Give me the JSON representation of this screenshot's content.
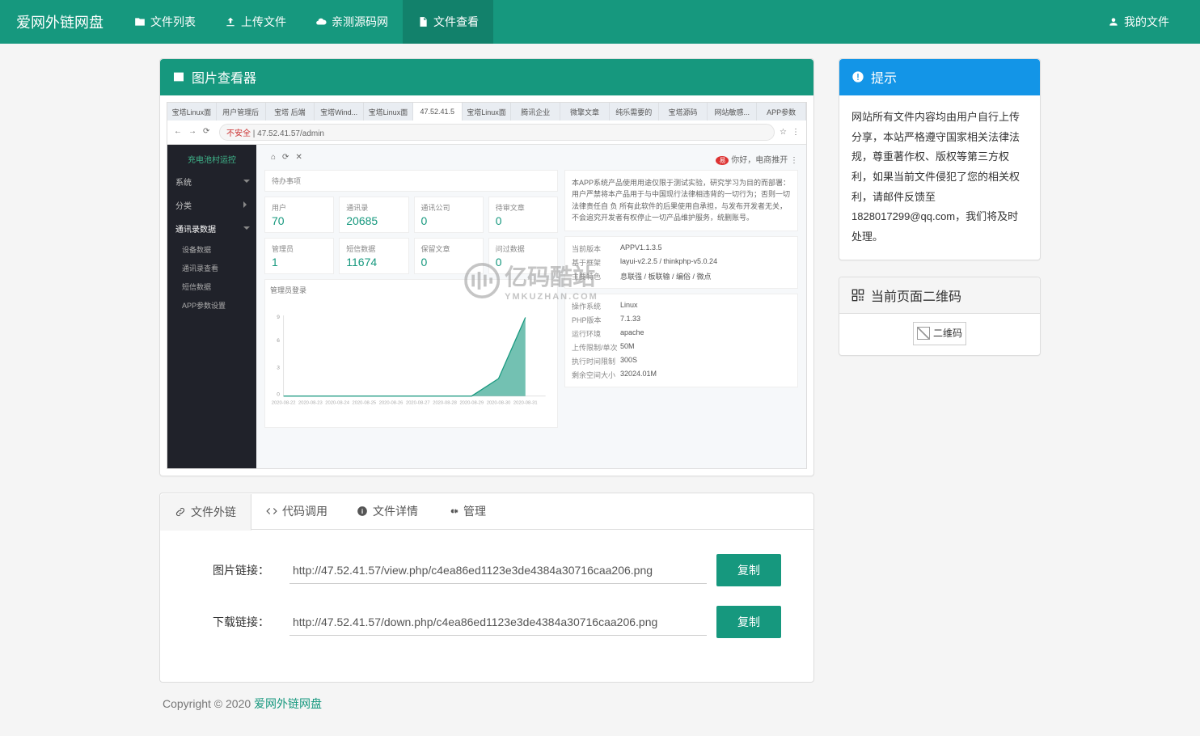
{
  "nav": {
    "brand": "爱网外链网盘",
    "items": [
      {
        "label": "文件列表",
        "icon": "folder-icon",
        "active": false
      },
      {
        "label": "上传文件",
        "icon": "upload-icon",
        "active": false
      },
      {
        "label": "亲测源码网",
        "icon": "cloud-icon",
        "active": false
      },
      {
        "label": "文件查看",
        "icon": "file-icon",
        "active": true
      }
    ],
    "right": {
      "label": "我的文件",
      "icon": "user-icon"
    }
  },
  "viewer": {
    "title": "图片查看器"
  },
  "screenshot": {
    "browser_tabs": [
      "宝塔Linux面",
      "用户管理后",
      "宝塔 后端",
      "宝塔Wind...",
      "宝塔Linux面",
      "47.52.41.5",
      "宝塔Linux面",
      "腾讯企业",
      "微擎文章",
      "纯乐需要的",
      "宝塔源码",
      "网站敏感...",
      "APP参数"
    ],
    "active_tab_index": 5,
    "url_security": "不安全",
    "url": "47.52.41.57/admin",
    "user_label": "你好，电商推开",
    "dashboard": {
      "logo": "充电池村运控",
      "menu": [
        {
          "label": "系统",
          "type": "expand"
        },
        {
          "label": "分类",
          "type": "collapse"
        },
        {
          "label": "通讯录数据",
          "type": "expand",
          "active": true
        },
        {
          "label": "设备数据",
          "type": "sub"
        },
        {
          "label": "通讯录查看",
          "type": "sub"
        },
        {
          "label": "短信数据",
          "type": "sub"
        },
        {
          "label": "APP参数设置",
          "type": "sub"
        }
      ],
      "pending_card": "待办事项",
      "stats": [
        {
          "label": "用户",
          "value": "70"
        },
        {
          "label": "通讯录",
          "value": "20685"
        },
        {
          "label": "通讯公司",
          "value": "0"
        },
        {
          "label": "待审文章",
          "value": "0"
        },
        {
          "label": "管理员",
          "value": "1"
        },
        {
          "label": "短信数据",
          "value": "11674"
        },
        {
          "label": "保留文章",
          "value": "0"
        },
        {
          "label": "问过数据",
          "value": "0"
        }
      ],
      "notice_text": "本APP系统产品使用用途仅限于测试实验，研究学习为目的而部署：用户严禁将本产品用于与中国现行法律相违背的一切行为；否则一切法律责任自 负 所有此软件的后果使用自承担，与发布开发者无关，不会追究开发者有权停止一切产品维护服务，统删账号。",
      "version_info": [
        {
          "k": "当前版本",
          "v": "APPV1.1.3.5"
        },
        {
          "k": "基于框架",
          "v": "layui-v2.2.5 / thinkphp-v5.0.24"
        },
        {
          "k": "主要特色",
          "v": "息联强 / 板联输 / 编俗 / 微点"
        }
      ],
      "sys_info": [
        {
          "k": "操作系统",
          "v": "Linux"
        },
        {
          "k": "PHP版本",
          "v": "7.1.33"
        },
        {
          "k": "运行环境",
          "v": "apache"
        },
        {
          "k": "上传限制/单次",
          "v": "50M"
        },
        {
          "k": "执行时间限制",
          "v": "300S"
        },
        {
          "k": "剩余空间大小",
          "v": "32024.01M"
        }
      ]
    }
  },
  "chart_data": {
    "type": "area",
    "title": "管理员登录",
    "categories": [
      "2020-08-22",
      "2020-08-23",
      "2020-08-24",
      "2020-08-25",
      "2020-08-26",
      "2020-08-27",
      "2020-08-28",
      "2020-08-29",
      "2020-08-30",
      "2020-08-31"
    ],
    "values": [
      0,
      0,
      0,
      0,
      0,
      0,
      0,
      0,
      2,
      9
    ],
    "ylim": [
      0,
      9
    ],
    "xlabel": "",
    "ylabel": ""
  },
  "tabs": {
    "items": [
      {
        "label": "文件外链",
        "icon": "link-icon",
        "active": true
      },
      {
        "label": "代码调用",
        "icon": "code-icon",
        "active": false
      },
      {
        "label": "文件详情",
        "icon": "info-icon",
        "active": false
      },
      {
        "label": "管理",
        "icon": "gear-icon",
        "active": false
      }
    ]
  },
  "links": {
    "image": {
      "label": "图片链接：",
      "value": "http://47.52.41.57/view.php/c4ea86ed1123e3de4384a30716caa206.png",
      "btn": "复制"
    },
    "download": {
      "label": "下载链接：",
      "value": "http://47.52.41.57/down.php/c4ea86ed1123e3de4384a30716caa206.png",
      "btn": "复制"
    }
  },
  "tips": {
    "title": "提示",
    "body": "网站所有文件内容均由用户自行上传分享，本站严格遵守国家相关法律法规，尊重著作权、版权等第三方权利，如果当前文件侵犯了您的相关权利，请邮件反馈至 1828017299@qq.com，我们将及时处理。"
  },
  "qr": {
    "title": "当前页面二维码",
    "alt": "二维码"
  },
  "footer": {
    "copyright": "Copyright © 2020 ",
    "link": "爱网外链网盘"
  }
}
